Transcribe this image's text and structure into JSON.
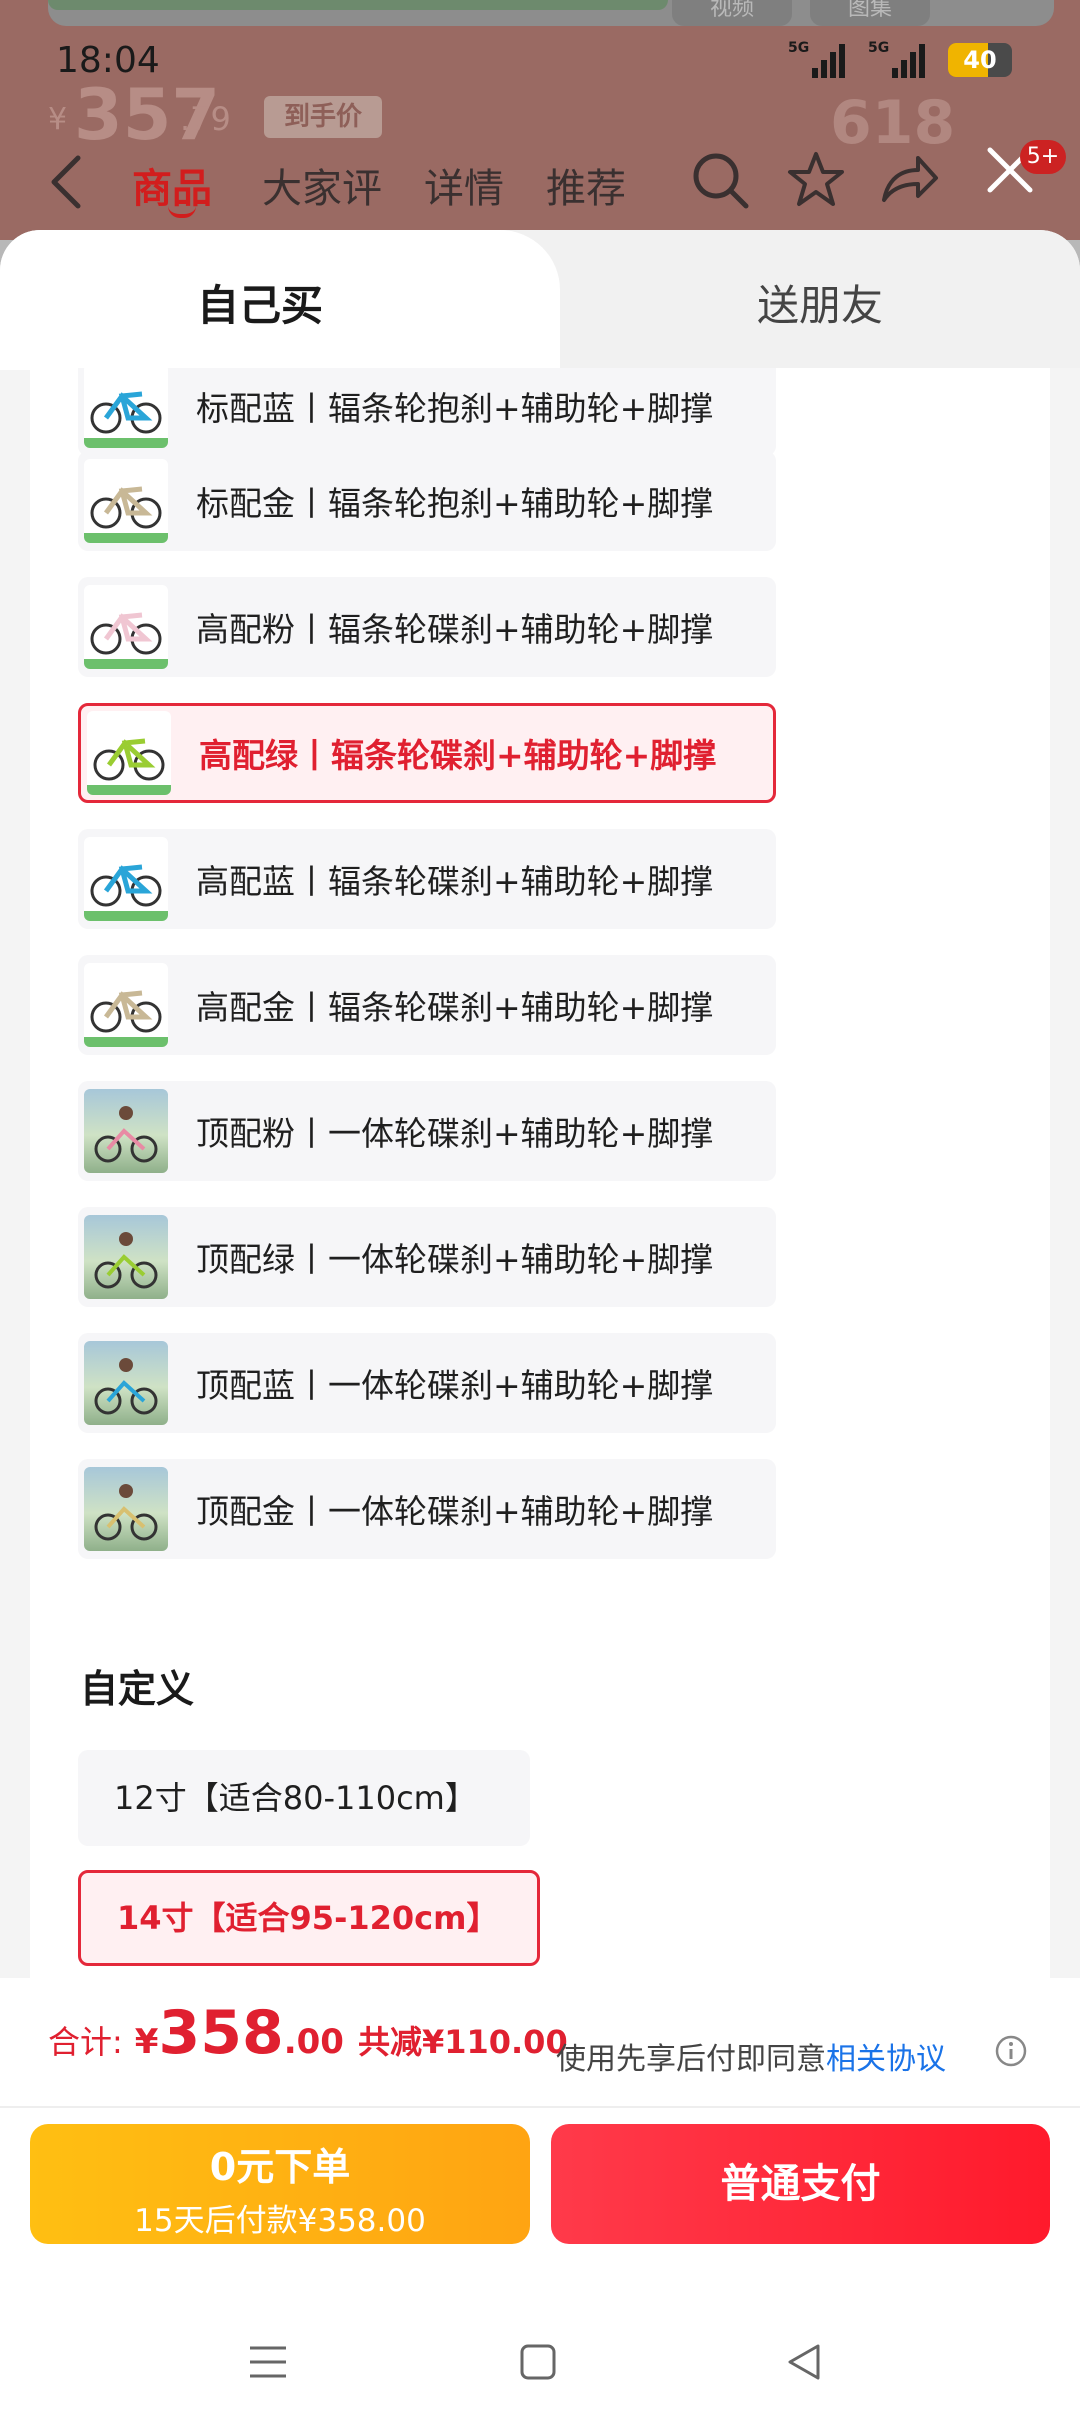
{
  "status_bar": {
    "time": "18:04",
    "network_1": "5G",
    "network_2": "5G",
    "battery": "40"
  },
  "background_page": {
    "top_pill_1": "视频",
    "top_pill_2": "图集",
    "price_symbol": "¥",
    "price_int": "357",
    "price_dec": ".79",
    "price_badge": "到手价",
    "promo": "618",
    "nav_tabs": [
      "商品",
      "大家评",
      "详情",
      "推荐"
    ],
    "badge_count": "5+"
  },
  "sheet": {
    "tab_self": "自己买",
    "tab_friend": "送朋友",
    "options": [
      {
        "label": "标配蓝丨辐条轮抱刹+辅助轮+脚撑",
        "selected": false,
        "thumb": "bike-blue"
      },
      {
        "label": "标配金丨辐条轮抱刹+辅助轮+脚撑",
        "selected": false,
        "thumb": "bike-gold"
      },
      {
        "label": "高配粉丨辐条轮碟刹+辅助轮+脚撑",
        "selected": false,
        "thumb": "bike-pink"
      },
      {
        "label": "高配绿丨辐条轮碟刹+辅助轮+脚撑",
        "selected": true,
        "thumb": "bike-green"
      },
      {
        "label": "高配蓝丨辐条轮碟刹+辅助轮+脚撑",
        "selected": false,
        "thumb": "bike-blue"
      },
      {
        "label": "高配金丨辐条轮碟刹+辅助轮+脚撑",
        "selected": false,
        "thumb": "bike-gold"
      },
      {
        "label": "顶配粉丨一体轮碟刹+辅助轮+脚撑",
        "selected": false,
        "thumb": "photo-pink"
      },
      {
        "label": "顶配绿丨一体轮碟刹+辅助轮+脚撑",
        "selected": false,
        "thumb": "photo-green"
      },
      {
        "label": "顶配蓝丨一体轮碟刹+辅助轮+脚撑",
        "selected": false,
        "thumb": "photo-blue"
      },
      {
        "label": "顶配金丨一体轮碟刹+辅助轮+脚撑",
        "selected": false,
        "thumb": "photo-gold"
      }
    ],
    "custom_section_title": "自定义",
    "sizes": [
      {
        "label": "12寸【适合80-110cm】",
        "selected": false
      },
      {
        "label": "14寸【适合95-120cm】",
        "selected": true
      }
    ]
  },
  "footer": {
    "total_label": "合计:",
    "total_yen": "¥",
    "total_int": "358",
    "total_dec": ".00",
    "total_saving": "共减¥110.00",
    "agreement_prefix": "使用先享后付即同意",
    "agreement_link": "相关协议",
    "bnpl_title": "0元下单",
    "bnpl_sub": "15天后付款¥358.00",
    "pay_label": "普通支付"
  },
  "colors": {
    "accent_red": "#e02030",
    "bnpl_orange": "#ffb012",
    "pay_red": "#ff2a3a"
  }
}
